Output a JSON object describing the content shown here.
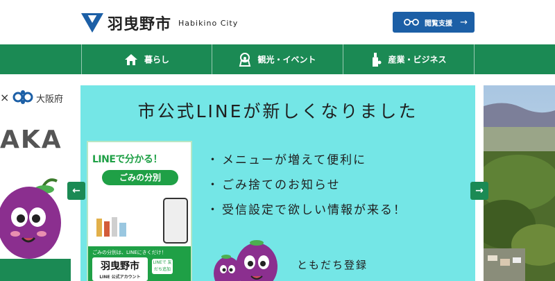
{
  "header": {
    "site_name": "羽曳野市",
    "site_name_en": "Habikino City",
    "access_button_label": "閲覧支援"
  },
  "nav": {
    "items": [
      {
        "label": "暮らし",
        "icon": "house-icon"
      },
      {
        "label": "観光・イベント",
        "icon": "keyhole-tomb-icon"
      },
      {
        "label": "産業・ビジネス",
        "icon": "bottle-icon"
      }
    ]
  },
  "carousel": {
    "left_slide": {
      "partner_mark": "×",
      "partner_name": "大阪府",
      "big_text": "AKA"
    },
    "main_slide": {
      "title": "市公式LINEが新しくなりました",
      "bullets": [
        "メニューが増えて便利に",
        "ごみ捨てのお知らせ",
        "受信設定で欲しい情報が来る！"
      ],
      "friend_text": "ともだち登録",
      "poster": {
        "headline_part1": "LINE",
        "headline_part2": "で分かる！",
        "ribbon": "ごみの分別",
        "note": "ごみの分別は、LINEにきくだけ！",
        "badge": "羽曳野市",
        "badge_sub": "LINE 公式アカウント",
        "line_tag": "LINEで 友だち追加"
      }
    },
    "prev_label": "←",
    "next_label": "→"
  },
  "colors": {
    "brand_green": "#1b8a54",
    "brand_blue": "#1c5fa6",
    "slide_bg": "#74e6e6",
    "line_green": "#1fa046"
  }
}
